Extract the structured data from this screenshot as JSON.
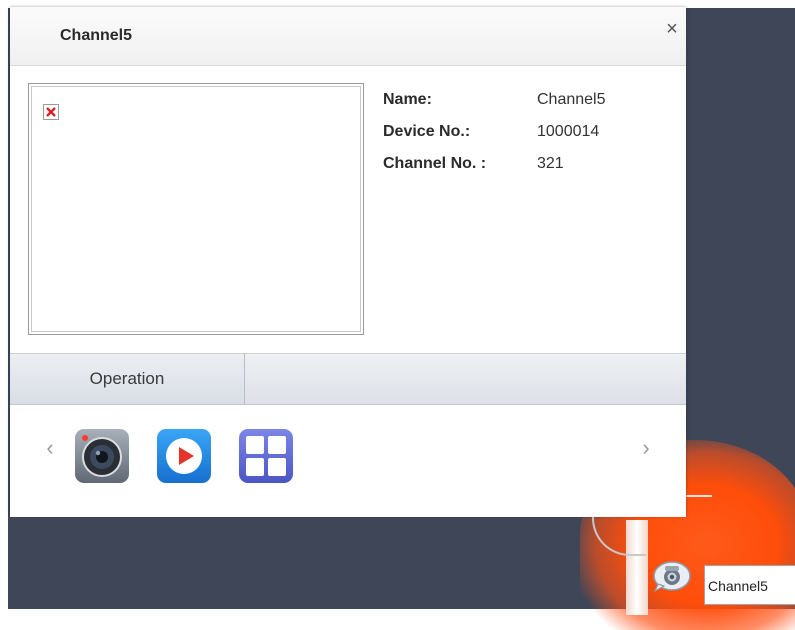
{
  "popup": {
    "title": "Channel5",
    "close_label": "×",
    "fields": [
      {
        "label": "Name:",
        "value": "Channel5"
      },
      {
        "label": "Device No.:",
        "value": "1000014"
      },
      {
        "label": "Channel No. :",
        "value": "321"
      }
    ],
    "tabs": [
      {
        "label": "Operation"
      }
    ],
    "nav": {
      "prev": "‹",
      "next": "›"
    },
    "actions": [
      {
        "name": "snapshot-camera",
        "icon": "camera-icon",
        "color": "#6e7a88"
      },
      {
        "name": "playback",
        "icon": "play-icon",
        "color": "#1f8ee6"
      },
      {
        "name": "multi-view-layout",
        "icon": "grid-icon",
        "color": "#5b6ad6"
      }
    ]
  },
  "map": {
    "marker_label": "Channel5",
    "marker_icon": "camera-marker-icon",
    "hotspot_color": "#ff4d0a",
    "background_color": "#3e4658"
  }
}
